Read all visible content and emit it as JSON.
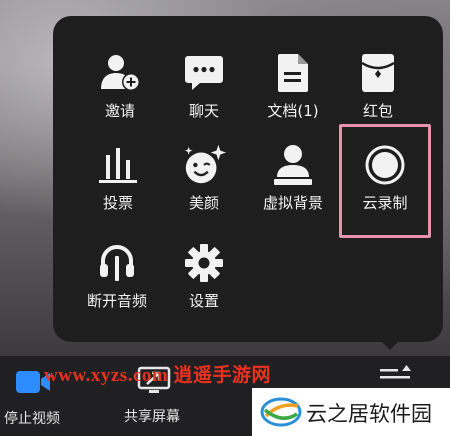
{
  "menu": {
    "items": [
      {
        "label": "邀请",
        "icon": "add-user-icon"
      },
      {
        "label": "聊天",
        "icon": "chat-icon"
      },
      {
        "label": "文档(1)",
        "icon": "document-icon"
      },
      {
        "label": "红包",
        "icon": "red-envelope-icon"
      },
      {
        "label": "投票",
        "icon": "poll-icon"
      },
      {
        "label": "美颜",
        "icon": "beauty-icon"
      },
      {
        "label": "虚拟背景",
        "icon": "virtual-background-icon"
      },
      {
        "label": "云录制",
        "icon": "record-icon"
      },
      {
        "label": "断开音频",
        "icon": "headphones-icon"
      },
      {
        "label": "设置",
        "icon": "gear-icon"
      }
    ],
    "highlighted": "云录制"
  },
  "toolbar": {
    "stop_video_label": "停止视频",
    "share_screen_label": "共享屏幕",
    "more_icon": "more-menu-icon"
  },
  "watermark": {
    "text": "www.xyzs.com 逍遥手游网"
  },
  "logo": {
    "text": "云之居软件园"
  },
  "colors": {
    "menu_bg": "#1e1e1f",
    "highlight_border": "#e893ab",
    "video_icon": "#2d8cff",
    "watermark": "#e8321f"
  }
}
